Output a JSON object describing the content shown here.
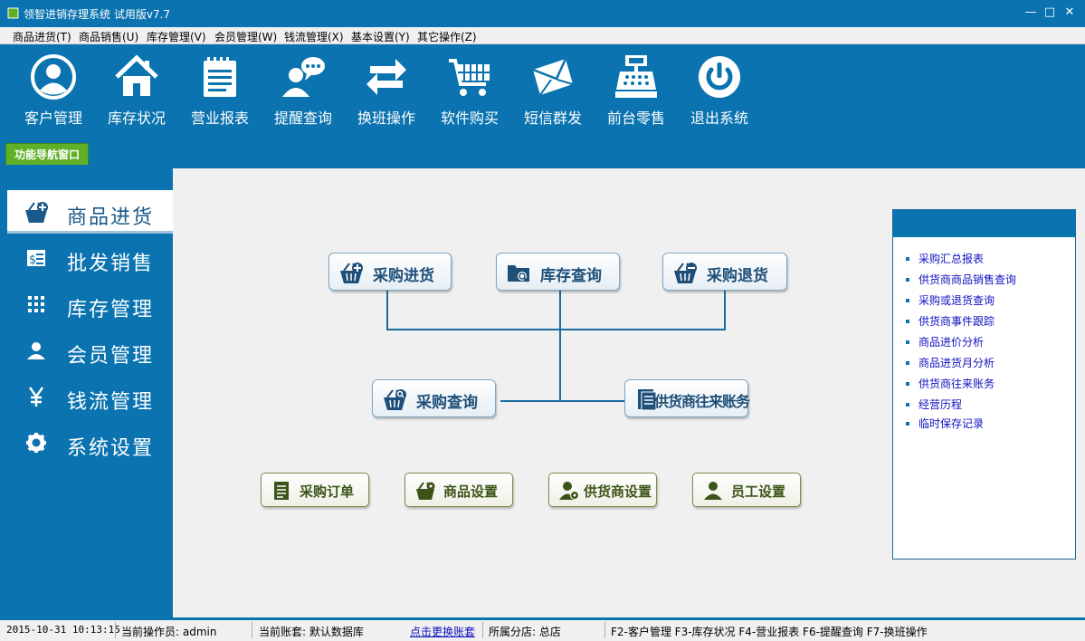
{
  "window": {
    "title": "领智进销存理系统 试用版v7.7",
    "minimize_icon": "minimize-icon",
    "maximize_icon": "maximize-icon",
    "close_icon": "close-icon"
  },
  "menu": [
    "商品进货(T)",
    "商品销售(U)",
    "库存管理(V)",
    "会员管理(W)",
    "钱流管理(X)",
    "基本设置(Y)",
    "其它操作(Z)"
  ],
  "toolbar": [
    {
      "label": "客户管理",
      "icon": "user-circle-icon"
    },
    {
      "label": "库存状况",
      "icon": "house-icon"
    },
    {
      "label": "营业报表",
      "icon": "notepad-icon"
    },
    {
      "label": "提醒查询",
      "icon": "chat-user-icon"
    },
    {
      "label": "换班操作",
      "icon": "swap-arrows-icon"
    },
    {
      "label": "软件购买",
      "icon": "shopping-cart-icon"
    },
    {
      "label": "短信群发",
      "icon": "envelope-icon"
    },
    {
      "label": "前台零售",
      "icon": "cash-register-icon"
    },
    {
      "label": "退出系统",
      "icon": "power-icon"
    }
  ],
  "tab": {
    "label": "功能导航窗口"
  },
  "left_nav": [
    {
      "label": "商品进货",
      "icon": "basket-plus-icon",
      "active": true
    },
    {
      "label": "批发销售",
      "icon": "receipt-dollar-icon",
      "active": false
    },
    {
      "label": "库存管理",
      "icon": "grid-icon",
      "active": false
    },
    {
      "label": "会员管理",
      "icon": "person-icon",
      "active": false
    },
    {
      "label": "钱流管理",
      "icon": "yen-icon",
      "active": false
    },
    {
      "label": "系统设置",
      "icon": "gear-icon",
      "active": false
    }
  ],
  "flow": {
    "purchase_in": "采购进货",
    "stock_query": "库存查询",
    "purchase_return": "采购退货",
    "purchase_query": "采购查询",
    "supplier_accounts": "供货商往来账务"
  },
  "bottom_buttons": {
    "purchase_order": "采购订单",
    "goods_settings": "商品设置",
    "supplier_settings": "供货商设置",
    "staff_settings": "员工设置"
  },
  "right_links": [
    "采购汇总报表",
    "供货商商品销售查询",
    "采购或退货查询",
    "供货商事件跟踪",
    "商品进价分析",
    "商品进货月分析",
    "供货商往来账务",
    "经营历程",
    "临时保存记录"
  ],
  "status": {
    "datetime": "2015-10-31 10:13:15",
    "operator": "当前操作员: admin",
    "account": "当前账套: 默认数据库",
    "switch_link": "点击更换账套",
    "branch": "所属分店: 总店",
    "shortcuts": "F2-客户管理 F3-库存状况 F4-营业报表 F6-提醒查询 F7-换班操作"
  },
  "colors": {
    "primary_blue": "#0a73b0",
    "tab_green": "#5fb026",
    "panel_bg": "#f0f0f0",
    "link_blue": "#1010c0"
  }
}
